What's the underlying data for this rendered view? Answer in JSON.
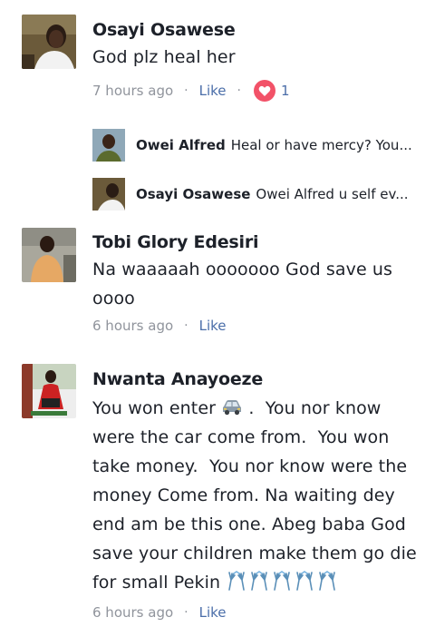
{
  "comments": [
    {
      "author": "Osayi Osawese",
      "text": "God plz heal her",
      "time": "7 hours ago",
      "like_label": "Like",
      "reaction_count": "1",
      "replies": [
        {
          "author": "Owei Alfred",
          "text": "Heal or have mercy? You..."
        },
        {
          "author": "Osayi Osawese",
          "text": "Owei Alfred u self ev..."
        }
      ]
    },
    {
      "author": "Tobi Glory Edesiri",
      "text_line1": "Na waaaaah ooooooo God save us",
      "text_line2": "oooo",
      "time": "6 hours ago",
      "like_label": "Like"
    },
    {
      "author": "Nwanta Anayoeze",
      "lines": [
        "You won enter",
        "were the car come from.  You won",
        "take money.  You nor know were the",
        "money Come from. Na waiting dey",
        "end am be this one. Abeg baba God",
        "save your children make them go die",
        "for small Pekin"
      ],
      "line1_tail": ".  You nor know",
      "time": "6 hours ago",
      "like_label": "Like"
    }
  ],
  "meta_dot": "·",
  "icons": {
    "heart": "heart-reaction-icon",
    "car": "automobile-emoji-icon",
    "hands": "raised-hands-emoji-icon"
  },
  "colors": {
    "link": "#4b6ea9",
    "meta": "#90949c",
    "heart": "#f25268"
  }
}
